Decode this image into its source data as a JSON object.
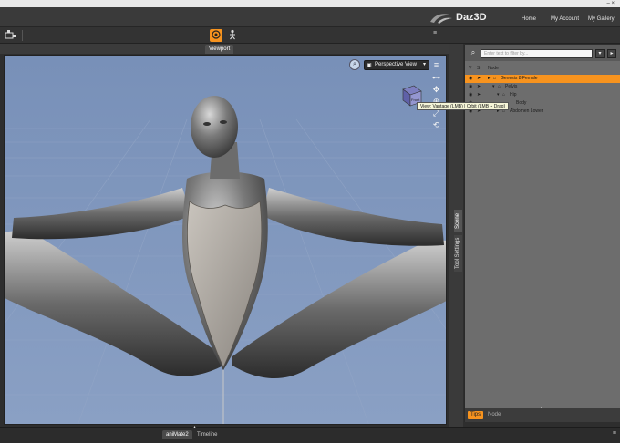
{
  "window": {
    "controls": "– ×"
  },
  "menubar": {
    "brand": "Daz3D",
    "nav": [
      "Home",
      "My Account",
      "My Gallery"
    ]
  },
  "toolbar": {
    "icons": [
      "render-settings-icon",
      "pose-tool-icon",
      "figure-tool-icon"
    ]
  },
  "viewport": {
    "tab_label": "Viewport",
    "camera_label": "Perspective View",
    "tooltip": "View: Vantage (LMB) | Orbit (LMB + Drag)",
    "background": "#7e95bb"
  },
  "side_tabs": [
    "Scene",
    "Tool Settings"
  ],
  "scene": {
    "search_placeholder": "Enter text to filter by...",
    "columns": [
      "V",
      "S",
      "Node"
    ],
    "rows": [
      {
        "label": "Genesis 8 Female",
        "selected": true
      },
      {
        "label": "Pelvis",
        "selected": false
      },
      {
        "label": "Hip",
        "selected": false
      },
      {
        "label": "Abdomen Lower",
        "selected": false
      }
    ],
    "partial_text": "Body",
    "bottom_tabs": [
      "Tips",
      "Node"
    ]
  },
  "bottom_tabs": [
    "aniMate2",
    "Timeline"
  ],
  "colors": {
    "accent": "#f7931e",
    "panel": "#6d6d6d"
  }
}
